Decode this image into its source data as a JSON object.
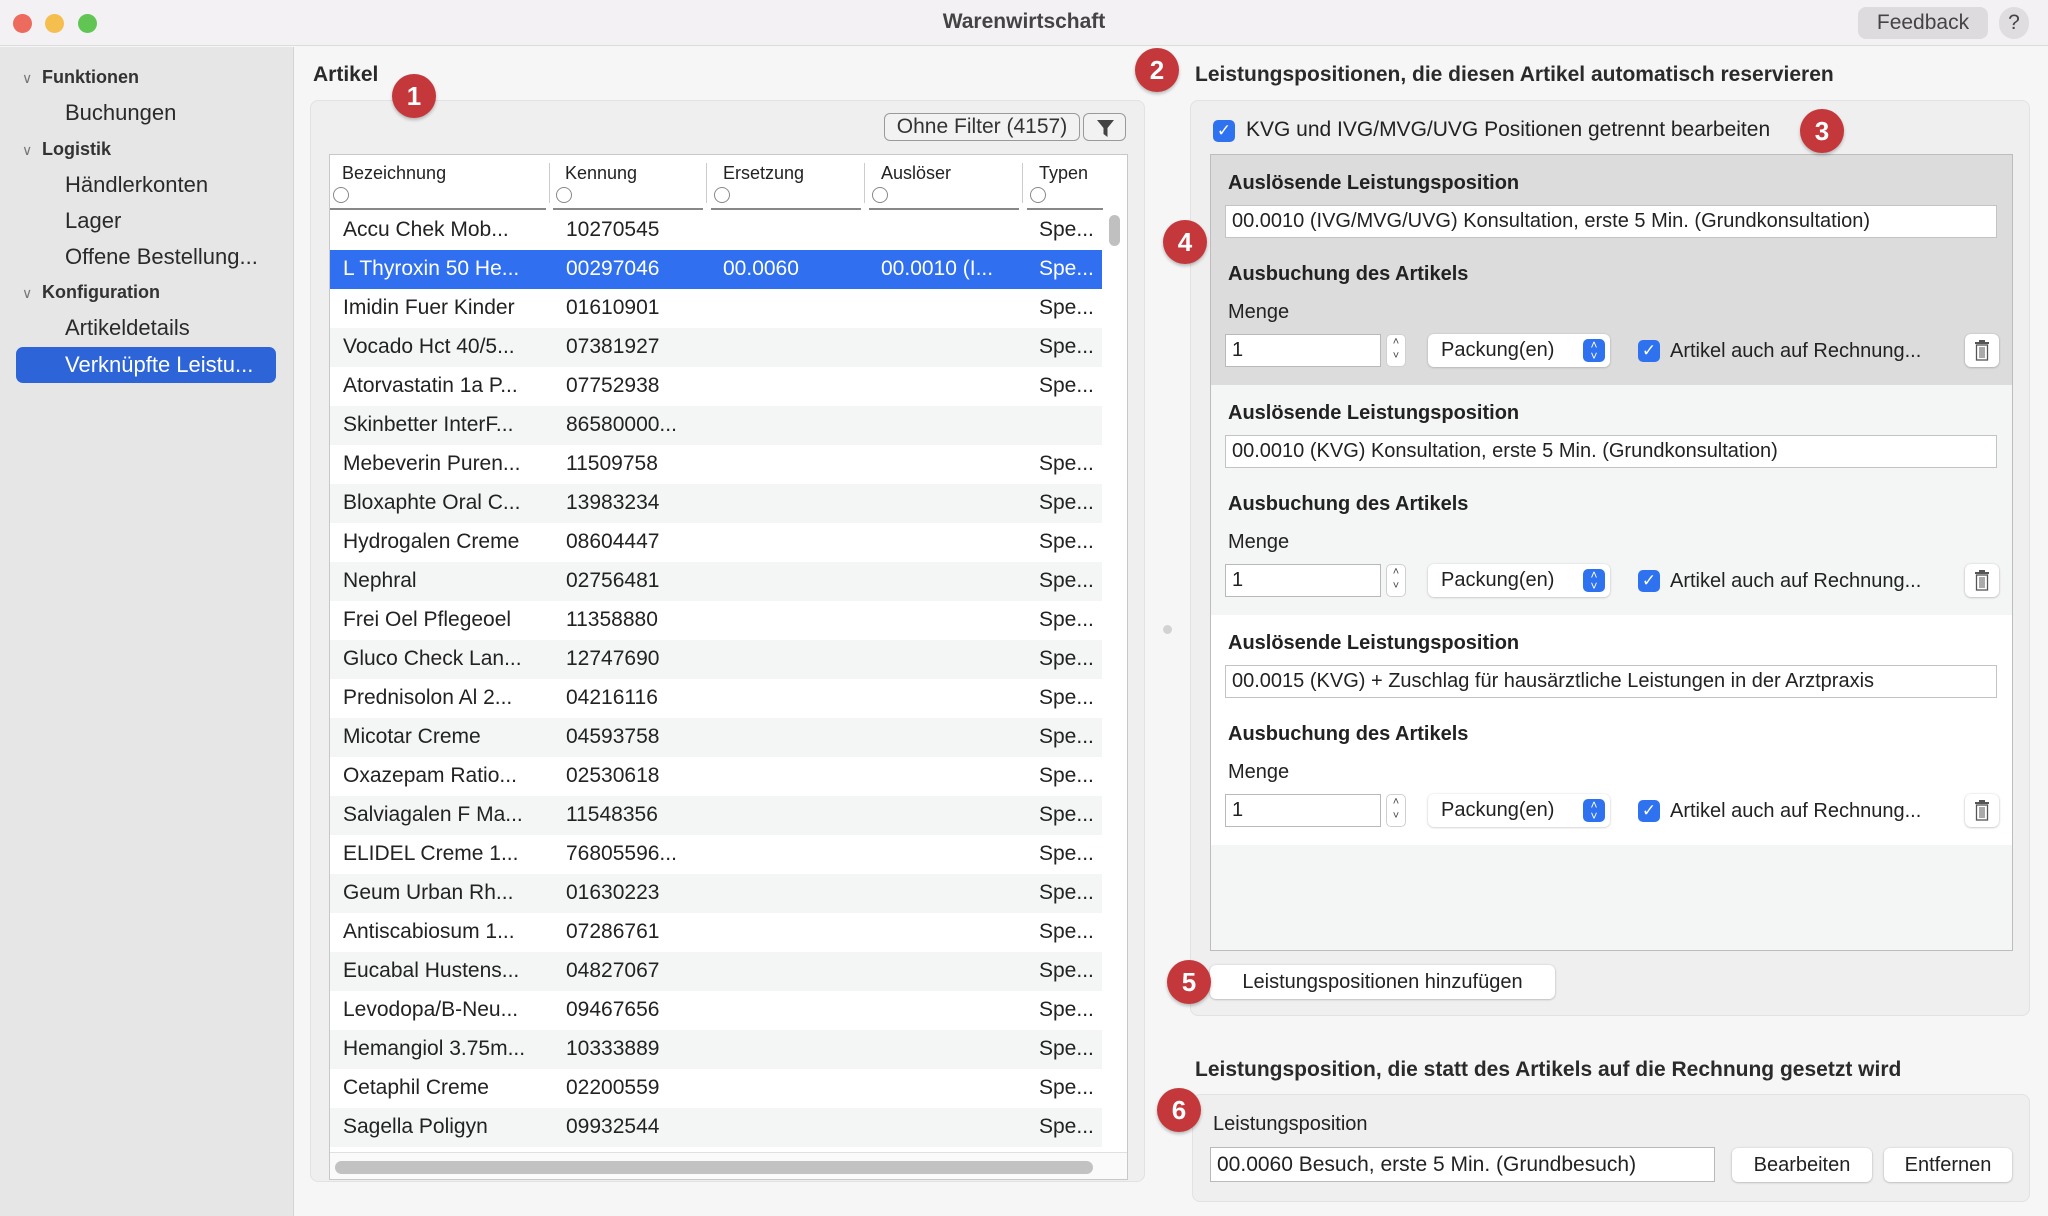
{
  "window": {
    "title": "Warenwirtschaft",
    "feedback_label": "Feedback",
    "help_label": "?"
  },
  "sidebar": {
    "groups": [
      {
        "label": "Funktionen",
        "items": [
          "Buchungen"
        ]
      },
      {
        "label": "Logistik",
        "items": [
          "Händlerkonten",
          "Lager",
          "Offene Bestellung..."
        ]
      },
      {
        "label": "Konfiguration",
        "items": [
          "Artikeldetails",
          "Verknüpfte Leistu..."
        ]
      }
    ],
    "active_item": "Verknüpfte Leistu..."
  },
  "artikel": {
    "title": "Artikel",
    "filter_label": "Ohne Filter (4157)",
    "columns": [
      "Bezeichnung",
      "Kennung",
      "Ersetzung",
      "Auslöser",
      "Typen"
    ],
    "rows": [
      [
        "Accu Chek Mob...",
        "10270545",
        "",
        "",
        "Spe..."
      ],
      [
        "L Thyroxin 50 He...",
        "00297046",
        "00.0060",
        "00.0010 (I...",
        "Spe..."
      ],
      [
        "Imidin Fuer Kinder",
        "01610901",
        "",
        "",
        "Spe..."
      ],
      [
        "Vocado Hct 40/5...",
        "07381927",
        "",
        "",
        "Spe..."
      ],
      [
        "Atorvastatin 1a P...",
        "07752938",
        "",
        "",
        "Spe..."
      ],
      [
        "Skinbetter InterF...",
        "86580000...",
        "",
        "",
        ""
      ],
      [
        "Mebeverin Puren...",
        "11509758",
        "",
        "",
        "Spe..."
      ],
      [
        "Bloxaphte Oral C...",
        "13983234",
        "",
        "",
        "Spe..."
      ],
      [
        "Hydrogalen Creme",
        "08604447",
        "",
        "",
        "Spe..."
      ],
      [
        "Nephral",
        "02756481",
        "",
        "",
        "Spe..."
      ],
      [
        "Frei Oel Pflegeoel",
        "11358880",
        "",
        "",
        "Spe..."
      ],
      [
        "Gluco Check Lan...",
        "12747690",
        "",
        "",
        "Spe..."
      ],
      [
        "Prednisolon Al 2...",
        "04216116",
        "",
        "",
        "Spe..."
      ],
      [
        "Micotar Creme",
        "04593758",
        "",
        "",
        "Spe..."
      ],
      [
        "Oxazepam Ratio...",
        "02530618",
        "",
        "",
        "Spe..."
      ],
      [
        "Salviagalen F Ma...",
        "11548356",
        "",
        "",
        "Spe..."
      ],
      [
        "ELIDEL Creme 1...",
        "76805596...",
        "",
        "",
        "Spe..."
      ],
      [
        "Geum Urban Rh...",
        "01630223",
        "",
        "",
        "Spe..."
      ],
      [
        "Antiscabiosum 1...",
        "07286761",
        "",
        "",
        "Spe..."
      ],
      [
        "Eucabal Hustens...",
        "04827067",
        "",
        "",
        "Spe..."
      ],
      [
        "Levodopa/B-Neu...",
        "09467656",
        "",
        "",
        "Spe..."
      ],
      [
        "Hemangiol 3.75m...",
        "10333889",
        "",
        "",
        "Spe..."
      ],
      [
        "Cetaphil Creme",
        "02200559",
        "",
        "",
        "Spe..."
      ],
      [
        "Sagella Poligyn",
        "09932544",
        "",
        "",
        "Spe..."
      ]
    ],
    "selected_row": 1
  },
  "reserve": {
    "title": "Leistungspositionen, die diesen Artikel automatisch reservieren",
    "separate_checkbox": {
      "label": "KVG und IVG/MVG/UVG Positionen getrennt bearbeiten",
      "checked": true
    },
    "positions": [
      {
        "heading": "Auslösende Leistungsposition",
        "value": "00.0010 (IVG/MVG/UVG) Konsultation, erste 5 Min. (Grundkonsultation)",
        "booking_heading": "Ausbuchung des Artikels",
        "menge_label": "Menge",
        "menge": "1",
        "unit": "Packung(en)",
        "invoice_checkbox": {
          "label": "Artikel auch auf Rechnung...",
          "checked": true
        }
      },
      {
        "heading": "Auslösende Leistungsposition",
        "value": "00.0010 (KVG) Konsultation, erste 5 Min. (Grundkonsultation)",
        "booking_heading": "Ausbuchung des Artikels",
        "menge_label": "Menge",
        "menge": "1",
        "unit": "Packung(en)",
        "invoice_checkbox": {
          "label": "Artikel auch auf Rechnung...",
          "checked": true
        }
      },
      {
        "heading": "Auslösende Leistungsposition",
        "value": "00.0015 (KVG) + Zuschlag für hausärztliche Leistungen in der Arztpraxis",
        "booking_heading": "Ausbuchung des Artikels",
        "menge_label": "Menge",
        "menge": "1",
        "unit": "Packung(en)",
        "invoice_checkbox": {
          "label": "Artikel auch auf Rechnung...",
          "checked": true
        }
      }
    ],
    "add_button": "Leistungspositionen hinzufügen"
  },
  "replacement": {
    "title": "Leistungsposition, die statt des Artikels auf die Rechnung gesetzt wird",
    "field_label": "Leistungsposition",
    "value": "00.0060 Besuch, erste 5 Min. (Grundbesuch)",
    "edit_button": "Bearbeiten",
    "remove_button": "Entfernen"
  },
  "badges": [
    "1",
    "2",
    "3",
    "4",
    "5",
    "6"
  ],
  "colors": {
    "accent": "#2f6ff0",
    "sidebar_active": "#2d64d8",
    "badge": "#c4373a"
  }
}
